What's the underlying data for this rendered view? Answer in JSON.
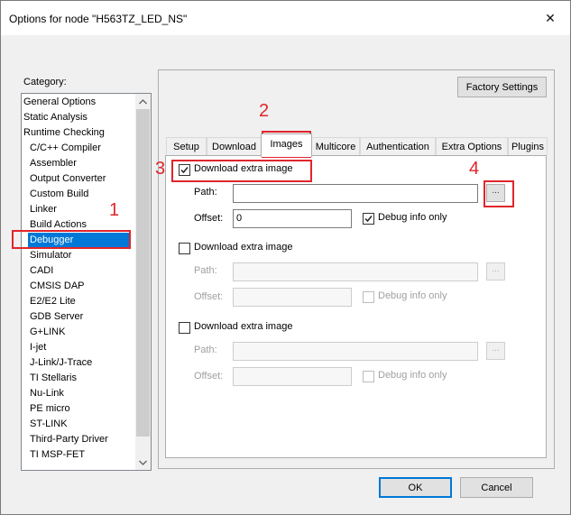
{
  "window": {
    "title": "Options for node \"H563TZ_LED_NS\"",
    "close_glyph": "✕"
  },
  "category": {
    "label": "Category:",
    "items": [
      {
        "label": "General Options",
        "indent": false,
        "selected": false
      },
      {
        "label": "Static Analysis",
        "indent": false,
        "selected": false
      },
      {
        "label": "Runtime Checking",
        "indent": false,
        "selected": false
      },
      {
        "label": "C/C++ Compiler",
        "indent": true,
        "selected": false
      },
      {
        "label": "Assembler",
        "indent": true,
        "selected": false
      },
      {
        "label": "Output Converter",
        "indent": true,
        "selected": false
      },
      {
        "label": "Custom Build",
        "indent": true,
        "selected": false
      },
      {
        "label": "Linker",
        "indent": true,
        "selected": false
      },
      {
        "label": "Build Actions",
        "indent": true,
        "selected": false
      },
      {
        "label": "Debugger",
        "indent": true,
        "selected": true
      },
      {
        "label": "Simulator",
        "indent": true,
        "selected": false
      },
      {
        "label": "CADI",
        "indent": true,
        "selected": false
      },
      {
        "label": "CMSIS DAP",
        "indent": true,
        "selected": false
      },
      {
        "label": "E2/E2 Lite",
        "indent": true,
        "selected": false
      },
      {
        "label": "GDB Server",
        "indent": true,
        "selected": false
      },
      {
        "label": "G+LINK",
        "indent": true,
        "selected": false
      },
      {
        "label": "I-jet",
        "indent": true,
        "selected": false
      },
      {
        "label": "J-Link/J-Trace",
        "indent": true,
        "selected": false
      },
      {
        "label": "TI Stellaris",
        "indent": true,
        "selected": false
      },
      {
        "label": "Nu-Link",
        "indent": true,
        "selected": false
      },
      {
        "label": "PE micro",
        "indent": true,
        "selected": false
      },
      {
        "label": "ST-LINK",
        "indent": true,
        "selected": false
      },
      {
        "label": "Third-Party Driver",
        "indent": true,
        "selected": false
      },
      {
        "label": "TI MSP-FET",
        "indent": true,
        "selected": false
      }
    ]
  },
  "factory_settings_label": "Factory Settings",
  "tabs": [
    {
      "label": "Setup",
      "active": false
    },
    {
      "label": "Download",
      "active": false
    },
    {
      "label": "Images",
      "active": true
    },
    {
      "label": "Multicore",
      "active": false
    },
    {
      "label": "Authentication",
      "active": false
    },
    {
      "label": "Extra Options",
      "active": false
    },
    {
      "label": "Plugins",
      "active": false
    }
  ],
  "images": [
    {
      "checkbox_label": "Download extra image",
      "checked": true,
      "enabled": true,
      "path_label": "Path:",
      "path_value": "",
      "offset_label": "Offset:",
      "offset_value": "0",
      "debug_label": "Debug info only",
      "debug_checked": true,
      "browse_label": "..."
    },
    {
      "checkbox_label": "Download extra image",
      "checked": false,
      "enabled": false,
      "path_label": "Path:",
      "path_value": "",
      "offset_label": "Offset:",
      "offset_value": "",
      "debug_label": "Debug info only",
      "debug_checked": false,
      "browse_label": "..."
    },
    {
      "checkbox_label": "Download extra image",
      "checked": false,
      "enabled": false,
      "path_label": "Path:",
      "path_value": "",
      "offset_label": "Offset:",
      "offset_value": "",
      "debug_label": "Debug info only",
      "debug_checked": false,
      "browse_label": "..."
    }
  ],
  "footer": {
    "ok_label": "OK",
    "cancel_label": "Cancel"
  },
  "annotations": {
    "color": "#e0252b",
    "numbers": [
      "1",
      "2",
      "3",
      "4"
    ]
  }
}
